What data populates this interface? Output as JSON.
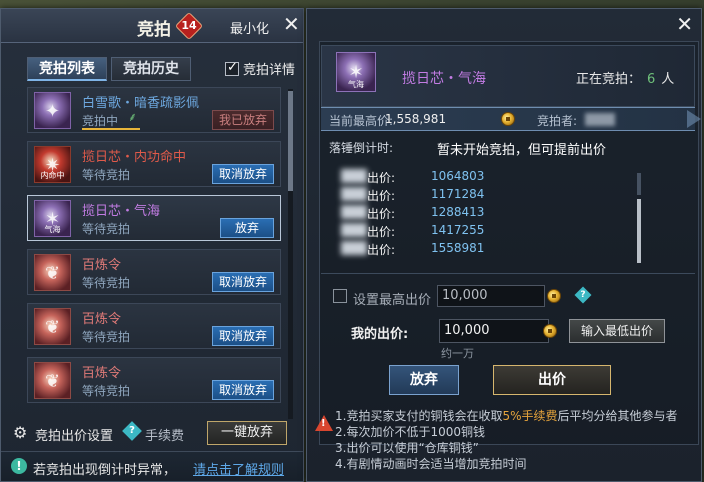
{
  "left": {
    "title": "竞拍",
    "count": "14",
    "minimize": "最小化",
    "close": "✕",
    "tabs": [
      {
        "label": "竞拍列表"
      },
      {
        "label": "竞拍历史"
      }
    ],
    "detail_toggle": {
      "label": "竞拍详情",
      "checked": true
    },
    "items": [
      {
        "name": "白雪歌・暗香疏影佩",
        "status": "竞拍中",
        "button": "我已放弃",
        "icon_text": "",
        "color": "blue"
      },
      {
        "name": "揽日芯・内功命中",
        "status": "等待竞拍",
        "button": "取消放弃",
        "icon_text": "内命中",
        "color": "red"
      },
      {
        "name": "揽日芯・气海",
        "status": "等待竞拍",
        "button": "放弃",
        "icon_text": "气海",
        "color": "purple"
      },
      {
        "name": "百炼令",
        "status": "等待竞拍",
        "button": "取消放弃",
        "icon_text": "",
        "color": "pink"
      },
      {
        "name": "百炼令",
        "status": "等待竞拍",
        "button": "取消放弃",
        "icon_text": "",
        "color": "pink"
      },
      {
        "name": "百炼令",
        "status": "等待竞拍",
        "button": "取消放弃",
        "icon_text": "",
        "color": "pink"
      }
    ],
    "bottom": {
      "bid_setting": "竞拍出价设置",
      "fee": "手续费",
      "abandon_all": "一键放弃"
    },
    "notice": {
      "text": "若竞拍出现倒计时异常，",
      "link": "请点击了解规则"
    }
  },
  "right": {
    "close": "✕",
    "item_name": "揽日芯・气海",
    "icon_text": "气海",
    "bidding_label": "正在竞拍：",
    "bidding_count": "6",
    "bidding_unit": "人",
    "highest_label": "当前最高价:",
    "highest_value": "1,558,981",
    "bidder_label": "竞拍者:",
    "countdown_label": "落锤倒计时:",
    "countdown_msg": "暂未开始竞拍，但可提前出价",
    "bids": [
      {
        "label": "出价:",
        "value": "1064803"
      },
      {
        "label": "出价:",
        "value": "1171284"
      },
      {
        "label": "出价:",
        "value": "1288413"
      },
      {
        "label": "出价:",
        "value": "1417255"
      },
      {
        "label": "出价:",
        "value": "1558981"
      }
    ],
    "max_bid": {
      "label": "设置最高出价",
      "value": "10,000",
      "checked": false
    },
    "my_bid": {
      "label": "我的出价:",
      "value": "10,000",
      "approx": "约一万"
    },
    "min_bid_button": "输入最低出价",
    "giveup_button": "放弃",
    "bid_button": "出价",
    "rules": {
      "line1_pre": "1.竞拍买家支付的铜钱会在收取",
      "line1_hl": "5%手续费",
      "line1_post": "后平均分给其他参与者",
      "line2": "2.每次加价不低于1000铜钱",
      "line3": "3.出价可以使用“仓库铜钱”",
      "line4": "4.有剧情动画时会适当增加竞拍时间"
    }
  },
  "colors": {
    "item_blue": "#6da7de",
    "item_red": "#e05a4a",
    "item_purple": "#c27ce3",
    "item_pink": "#e07a78",
    "status_green": "#6ec07a",
    "bid_value": "#7fc2f0",
    "fee_highlight": "#e6a43c"
  }
}
